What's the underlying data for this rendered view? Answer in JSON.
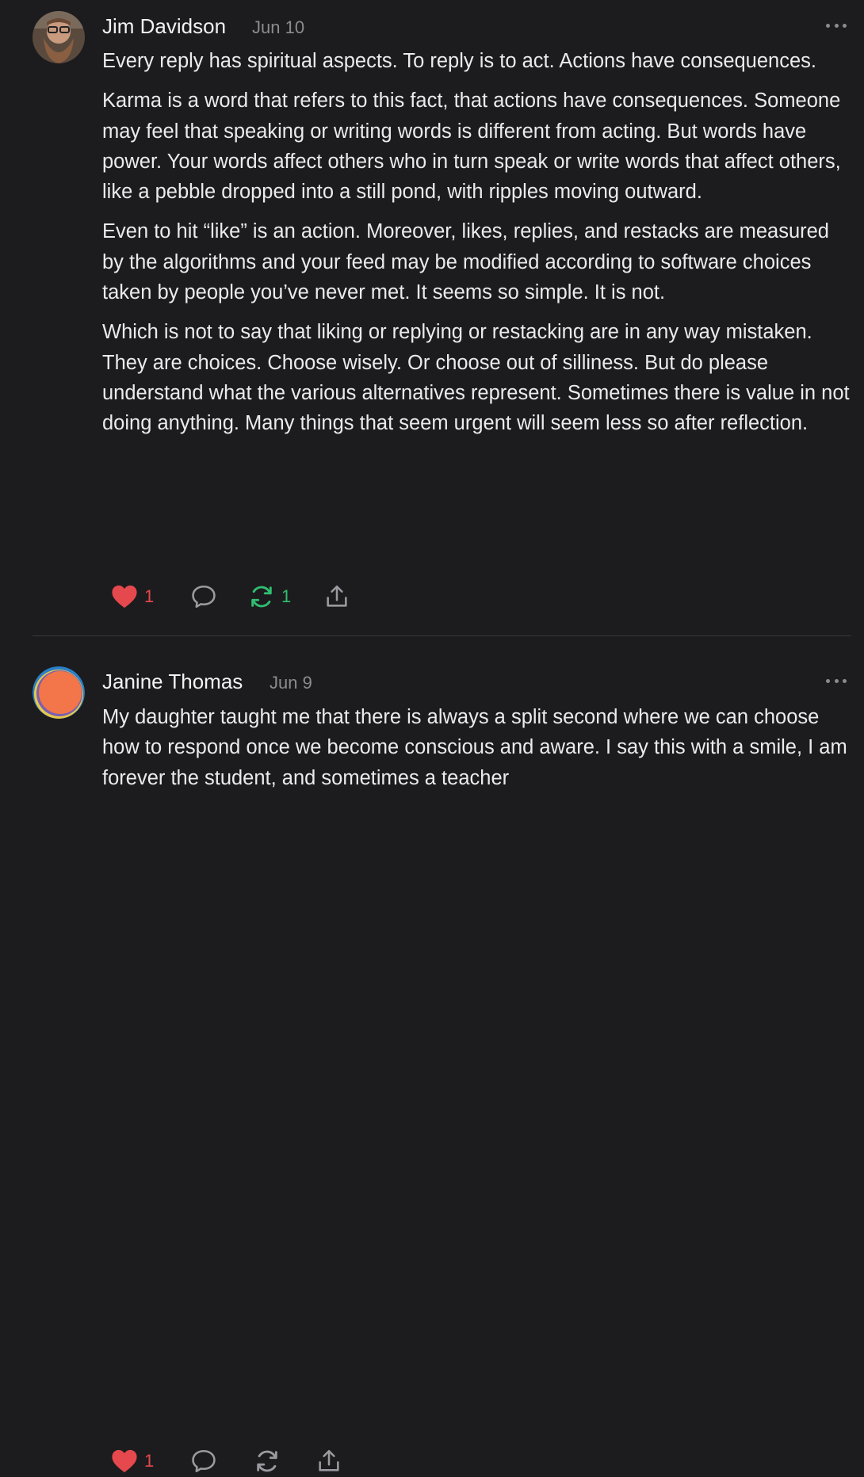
{
  "posts": [
    {
      "author": "Jim Davidson",
      "date": "Jun 10",
      "paragraphs": [
        "Every reply has spiritual aspects. To reply is to act. Actions have consequences.",
        "Karma is a word that refers to this fact, that actions have consequences. Someone may feel that speaking or writing words is different from acting. But words have power. Your words affect others who in turn speak or write words that affect others, like a pebble dropped into a still pond, with ripples moving outward.",
        "Even to hit “like” is an action. Moreover, likes, replies, and restacks are measured by the algorithms and your feed may be modified according to software choices taken by people you’ve never met. It seems so simple. It is not.",
        "Which is not to say that liking or replying or restacking are in any way mistaken. They are choices. Choose wisely. Or choose out of silliness. But do please understand what the various alternatives represent. Sometimes there is value in not doing anything. Many things that seem urgent will seem less so after reflection."
      ],
      "likes": "1",
      "restacks": "1",
      "liked": true,
      "restacked": true
    },
    {
      "author": "Janine Thomas",
      "date": "Jun 9",
      "paragraphs": [
        "My daughter taught me that there is always a split second where we can choose how to respond once we become conscious and aware. I say this with a smile, I am forever the student, and sometimes a teacher"
      ],
      "likes": "1",
      "restacks": "",
      "liked": true,
      "restacked": false
    }
  ],
  "icons": {
    "like": "heart-icon",
    "comment": "comment-bubble-icon",
    "restack": "restack-icon",
    "share": "share-icon",
    "more": "more-options-icon"
  },
  "colors": {
    "background": "#1c1c1e",
    "text": "#ebebed",
    "muted": "#8c8c90",
    "like": "#e5484d",
    "restack_active": "#2fbf71",
    "icon": "#9a9aa0"
  }
}
